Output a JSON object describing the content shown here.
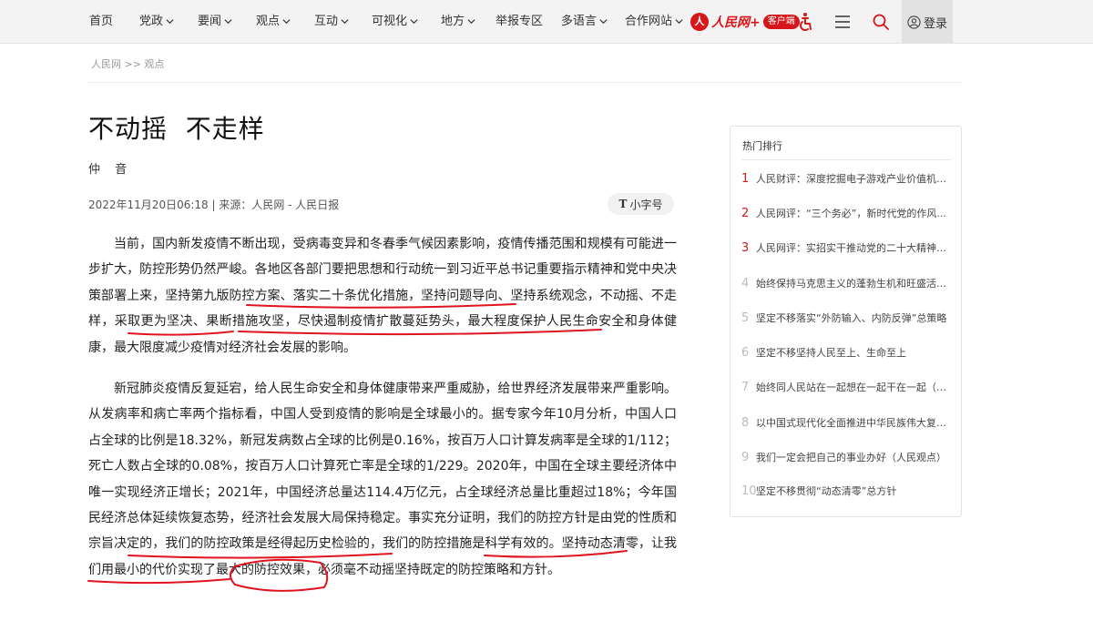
{
  "nav": {
    "items": [
      {
        "label": "首页",
        "caret": false
      },
      {
        "label": "党政",
        "caret": true
      },
      {
        "label": "要闻",
        "caret": true
      },
      {
        "label": "观点",
        "caret": true
      },
      {
        "label": "互动",
        "caret": true
      },
      {
        "label": "可视化",
        "caret": true
      },
      {
        "label": "地方",
        "caret": true
      },
      {
        "label": "举报专区",
        "caret": false
      },
      {
        "label": "多语言",
        "caret": true
      },
      {
        "label": "合作网站",
        "caret": true
      }
    ],
    "app_logo_text": "人民网+",
    "app_logo_mark": "人",
    "app_badge": "客户端",
    "login_label": "登录",
    "icons": [
      "accessibility-icon",
      "menu-icon",
      "search-icon",
      "user-icon"
    ]
  },
  "breadcrumb": "人民网 >> 观点",
  "article": {
    "title": "不动摇  不走样",
    "author": "仲 音",
    "meta": "2022年11月20日06:18 | 来源：人民网 - 人民日报",
    "font_size_icon": "T",
    "font_size_label": "小字号",
    "paragraphs": [
      "当前，国内新发疫情不断出现，受病毒变异和冬春季气候因素影响，疫情传播范围和规模有可能进一步扩大，防控形势仍然严峻。各地区各部门要把思想和行动统一到习近平总书记重要指示精神和党中央决策部署上来，坚持第九版防控方案、落实二十条优化措施，坚持问题导向、坚持系统观念，不动摇、不走样，采取更为坚决、果断措施攻坚，尽快遏制疫情扩散蔓延势头，最大程度保护人民生命安全和身体健康，最大限度减少疫情对经济社会发展的影响。",
      "新冠肺炎疫情反复延宕，给人民生命安全和身体健康带来严重威胁，给世界经济发展带来严重影响。从发病率和病亡率两个指标看，中国人受到疫情的影响是全球最小的。据专家今年10月分析，中国人口占全球的比例是18.32%，新冠发病数占全球的比例是0.16%，按百万人口计算发病率是全球的1/112；死亡人数占全球的0.08%，按百万人口计算死亡率是全球的1/229。2020年，中国在全球主要经济体中唯一实现经济正增长；2021年，中国经济总量达114.4万亿元，占全球经济总量比重超过18%；今年国民经济总体延续恢复态势，经济社会发展大局保持稳定。事实充分证明，我们的防控方针是由党的性质和宗旨决定的，我们的防控政策是经得起历史检验的，我们的防控措施是科学有效的。坚持动态清零，让我们用最小的代价实现了最大的防控效果，必须毫不动摇坚持既定的防控策略和方针。"
    ]
  },
  "sidebar": {
    "title": "热门排行",
    "items": [
      {
        "num": "1",
        "text": "人民财评：深度挖掘电子游戏产业价值机不..."
      },
      {
        "num": "2",
        "text": "人民网评：“三个务必”，新时代党的作风..."
      },
      {
        "num": "3",
        "text": "人民网评：实招实干推动党的二十大精神落..."
      },
      {
        "num": "4",
        "text": "始终保持马克思主义的蓬勃生机和旺盛活力..."
      },
      {
        "num": "5",
        "text": "坚定不移落实“外防输入、内防反弹”总策略"
      },
      {
        "num": "6",
        "text": "坚定不移坚持人民至上、生命至上"
      },
      {
        "num": "7",
        "text": "始终同人民站在一起想在一起干在一起（人..."
      },
      {
        "num": "8",
        "text": "以中国式现代化全面推进中华民族伟大复兴..."
      },
      {
        "num": "9",
        "text": "我们一定会把自己的事业办好（人民观点）"
      },
      {
        "num": "10",
        "text": "坚定不移贯彻“动态清零”总方针"
      }
    ]
  },
  "colors": {
    "accent": "#d7161b",
    "nav_bg": "#f3f3f3",
    "ink": "#e0141e"
  }
}
